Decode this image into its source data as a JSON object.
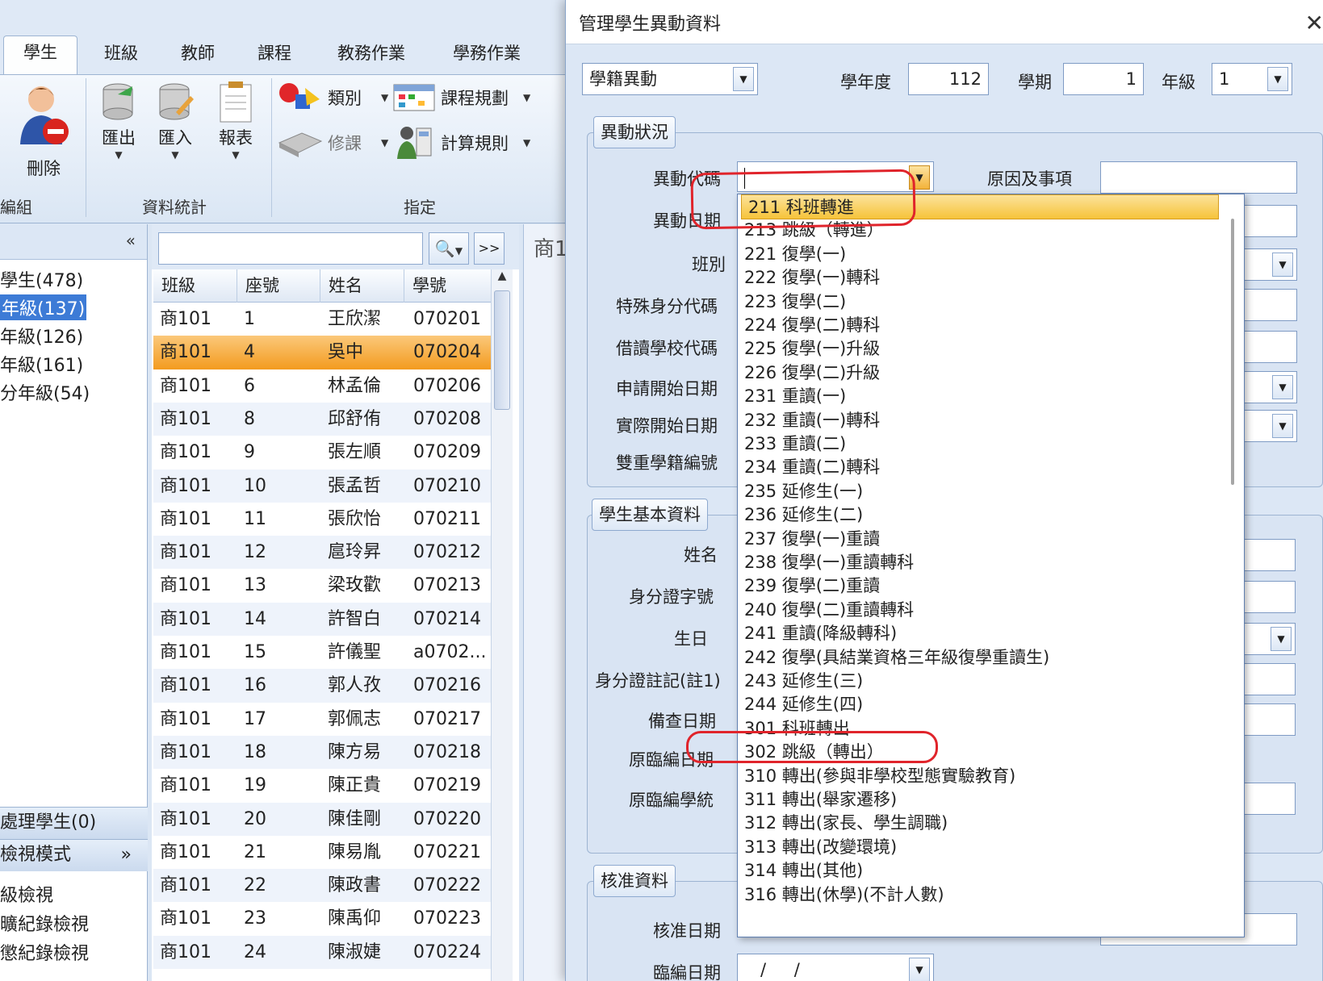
{
  "ribbon": {
    "tabs": [
      "學生",
      "班級",
      "教師",
      "課程",
      "教務作業",
      "學務作業"
    ],
    "active_tab": "學生",
    "delete_label": "刪除",
    "export_label": "匯出",
    "import_label": "匯入",
    "report_label": "報表",
    "category_label": "類別",
    "course_plan_label": "課程規劃",
    "elective_label": "修課",
    "calc_rule_label": "計算規則",
    "group_data_stats": "資料統計",
    "group_assign": "指定",
    "group_edit_partial": "編組"
  },
  "tree": {
    "items": [
      "學生(478)",
      "年級(137)",
      "年級(126)",
      "年級(161)",
      "分年級(54)"
    ],
    "pending": "處理學生(0)",
    "view_mode": "檢視模式",
    "links": [
      "級檢視",
      "曠紀錄檢視",
      "懲紀錄檢視"
    ]
  },
  "list": {
    "headers": [
      "班級",
      "座號",
      "姓名",
      "學號"
    ],
    "next_label": ">>",
    "rows": [
      {
        "cls": "商101",
        "seat": "1",
        "name": "王欣潔",
        "id": "070201"
      },
      {
        "cls": "商101",
        "seat": "4",
        "name": "吳中",
        "id": "070204"
      },
      {
        "cls": "商101",
        "seat": "6",
        "name": "林孟倫",
        "id": "070206"
      },
      {
        "cls": "商101",
        "seat": "8",
        "name": "邱舒侑",
        "id": "070208"
      },
      {
        "cls": "商101",
        "seat": "9",
        "name": "張左順",
        "id": "070209"
      },
      {
        "cls": "商101",
        "seat": "10",
        "name": "張孟哲",
        "id": "070210"
      },
      {
        "cls": "商101",
        "seat": "11",
        "name": "張欣怡",
        "id": "070211"
      },
      {
        "cls": "商101",
        "seat": "12",
        "name": "扈玲昇",
        "id": "070212"
      },
      {
        "cls": "商101",
        "seat": "13",
        "name": "梁玫歡",
        "id": "070213"
      },
      {
        "cls": "商101",
        "seat": "14",
        "name": "許智白",
        "id": "070214"
      },
      {
        "cls": "商101",
        "seat": "15",
        "name": "許儀聖",
        "id": "a0702..."
      },
      {
        "cls": "商101",
        "seat": "16",
        "name": "郭人孜",
        "id": "070216"
      },
      {
        "cls": "商101",
        "seat": "17",
        "name": "郭佩志",
        "id": "070217"
      },
      {
        "cls": "商101",
        "seat": "18",
        "name": "陳方易",
        "id": "070218"
      },
      {
        "cls": "商101",
        "seat": "19",
        "name": "陳正貴",
        "id": "070219"
      },
      {
        "cls": "商101",
        "seat": "20",
        "name": "陳佳剛",
        "id": "070220"
      },
      {
        "cls": "商101",
        "seat": "21",
        "name": "陳易胤",
        "id": "070221"
      },
      {
        "cls": "商101",
        "seat": "22",
        "name": "陳政書",
        "id": "070222"
      },
      {
        "cls": "商101",
        "seat": "23",
        "name": "陳禹仰",
        "id": "070223"
      },
      {
        "cls": "商101",
        "seat": "24",
        "name": "陳淑婕",
        "id": "070224"
      }
    ],
    "peek": "商1"
  },
  "dialog": {
    "title": "管理學生異動資料",
    "close": "✕",
    "type_value": "學籍異動",
    "year_label": "學年度",
    "year_value": "112",
    "term_label": "學期",
    "term_value": "1",
    "grade_label": "年級",
    "grade_value": "1",
    "fs_change": "異動狀況",
    "fs_basic": "學生基本資料",
    "fs_approve": "核准資料",
    "labels": {
      "code": "異動代碼",
      "reason": "原因及事項",
      "date": "異動日期",
      "class": "班別",
      "special": "特殊身分代碼",
      "borrow": "借讀學校代碼",
      "apply_start": "申請開始日期",
      "actual_start": "實際開始日期",
      "dual": "雙重學籍編號",
      "name": "姓名",
      "idno": "身分證字號",
      "birthday": "生日",
      "id_note": "身分證註記(註1)",
      "check_date": "備查日期",
      "orig_date": "原臨編日期",
      "orig_sys": "原臨編學統",
      "approve_date": "核准日期",
      "temp_date": "臨編日期"
    },
    "temp_date_value": "/ /"
  },
  "dropdown": {
    "items": [
      "211 科班轉進",
      "213 跳級（轉進）",
      "221 復學(一)",
      "222 復學(一)轉科",
      "223 復學(二)",
      "224 復學(二)轉科",
      "225 復學(一)升級",
      "226 復學(二)升級",
      "231 重讀(一)",
      "232 重讀(一)轉科",
      "233 重讀(二)",
      "234 重讀(二)轉科",
      "235 延修生(一)",
      "236 延修生(二)",
      "237 復學(一)重讀",
      "238 復學(一)重讀轉科",
      "239 復學(二)重讀",
      "240 復學(二)重讀轉科",
      "241 重讀(降級轉科)",
      "242 復學(具結業資格三年級復學重讀生)",
      "243 延修生(三)",
      "244 延修生(四)",
      "301 科班轉出",
      "302 跳級（轉出）",
      "310 轉出(參與非學校型態實驗教育)",
      "311 轉出(舉家遷移)",
      "312 轉出(家長、學生調職)",
      "313 轉出(改變環境)",
      "314 轉出(其他)",
      "316 轉出(休學)(不計人數)"
    ],
    "highlighted_index": 0
  },
  "colors": {
    "selection_orange": "#f39b1f",
    "highlight_yellow": "#f6c33a",
    "annotation_red": "#e0242b",
    "tree_selection": "#3d7bd6"
  }
}
